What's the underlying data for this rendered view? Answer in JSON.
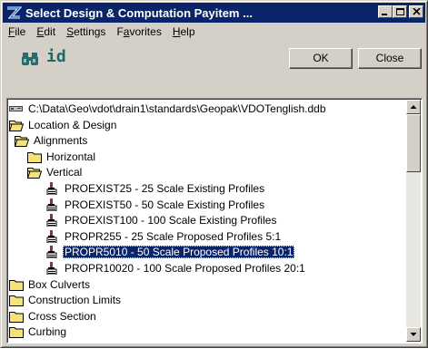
{
  "window": {
    "title": "Select Design & Computation Payitem ..."
  },
  "menu": [
    {
      "label": "File",
      "mnemonic": "F",
      "rest": "ile"
    },
    {
      "label": "Edit",
      "mnemonic": "E",
      "rest": "dit"
    },
    {
      "label": "Settings",
      "mnemonic": "S",
      "rest": "ettings"
    },
    {
      "label": "Favorites",
      "mnemonic": "a",
      "pre": "F",
      "rest": "vorites"
    },
    {
      "label": "Help",
      "mnemonic": "H",
      "rest": "elp"
    }
  ],
  "toolbar": {
    "find_icon": "binoculars-icon",
    "id_label": "id",
    "ok_label": "OK",
    "close_label": "Close"
  },
  "tree": {
    "items": [
      {
        "label": "C:\\Data\\Geo\\vdot\\drain1\\standards\\Geopak\\VDOTenglish.ddb",
        "icon": "database-icon",
        "level": 0
      },
      {
        "label": "Location & Design",
        "icon": "folder-open-icon",
        "level": 0
      },
      {
        "label": "Alignments",
        "icon": "folder-open-icon",
        "level": 1
      },
      {
        "label": "Horizontal",
        "icon": "folder-icon",
        "level": 2
      },
      {
        "label": "Vertical",
        "icon": "folder-open-icon",
        "level": 2
      },
      {
        "label": "PROEXIST25 - 25 Scale Existing Profiles",
        "icon": "payitem-icon",
        "level": 3
      },
      {
        "label": "PROEXIST50 - 50 Scale Existing Profiles",
        "icon": "payitem-icon",
        "level": 3
      },
      {
        "label": "PROEXIST100 - 100 Scale Existing Profiles",
        "icon": "payitem-icon",
        "level": 3
      },
      {
        "label": "PROPR255 - 25 Scale Proposed Profiles 5:1",
        "icon": "payitem-icon",
        "level": 3
      },
      {
        "label": "PROPR5010 - 50 Scale Proposed Profiles 10:1",
        "icon": "payitem-icon",
        "level": 3,
        "selected": true
      },
      {
        "label": "PROPR10020 - 100 Scale Proposed Profiles 20:1",
        "icon": "payitem-icon",
        "level": 3
      },
      {
        "label": "Box Culverts",
        "icon": "folder-icon",
        "level": 0
      },
      {
        "label": "Construction Limits",
        "icon": "folder-icon",
        "level": 0
      },
      {
        "label": "Cross Section",
        "icon": "folder-icon",
        "level": 0
      },
      {
        "label": "Curbing",
        "icon": "folder-icon",
        "level": 0
      }
    ]
  },
  "colors": {
    "title_bar": "#0a246a",
    "selection": "#0a246a",
    "face": "#d4d0c8",
    "folder": "#f4e27a"
  }
}
